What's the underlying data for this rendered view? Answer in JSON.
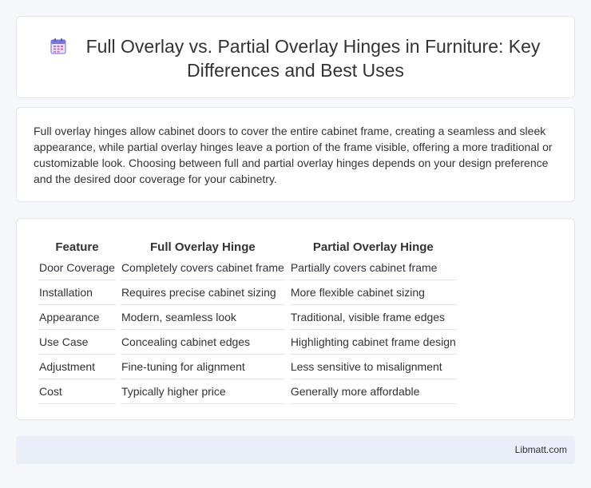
{
  "header": {
    "icon": "calendar-icon",
    "title_line1": "Full Overlay vs. Partial Overlay Hinges in Furniture: Key",
    "title_line2": "Differences and Best Uses"
  },
  "intro": {
    "text": "Full overlay hinges allow cabinet doors to cover the entire cabinet frame, creating a seamless and sleek appearance, while partial overlay hinges leave a portion of the frame visible, offering a more traditional or customizable look. Choosing between full and partial overlay hinges depends on your design preference and the desired door coverage for your cabinetry."
  },
  "table": {
    "headers": [
      "Feature",
      "Full Overlay Hinge",
      "Partial Overlay Hinge"
    ],
    "rows": [
      [
        "Door Coverage",
        "Completely covers cabinet frame",
        "Partially covers cabinet frame"
      ],
      [
        "Installation",
        "Requires precise cabinet sizing",
        "More flexible cabinet sizing"
      ],
      [
        "Appearance",
        "Modern, seamless look",
        "Traditional, visible frame edges"
      ],
      [
        "Use Case",
        "Concealing cabinet edges",
        "Highlighting cabinet frame design"
      ],
      [
        "Adjustment",
        "Fine-tuning for alignment",
        "Less sensitive to misalignment"
      ],
      [
        "Cost",
        "Typically higher price",
        "Generally more affordable"
      ]
    ]
  },
  "footer": {
    "site": "Libmatt.com"
  }
}
